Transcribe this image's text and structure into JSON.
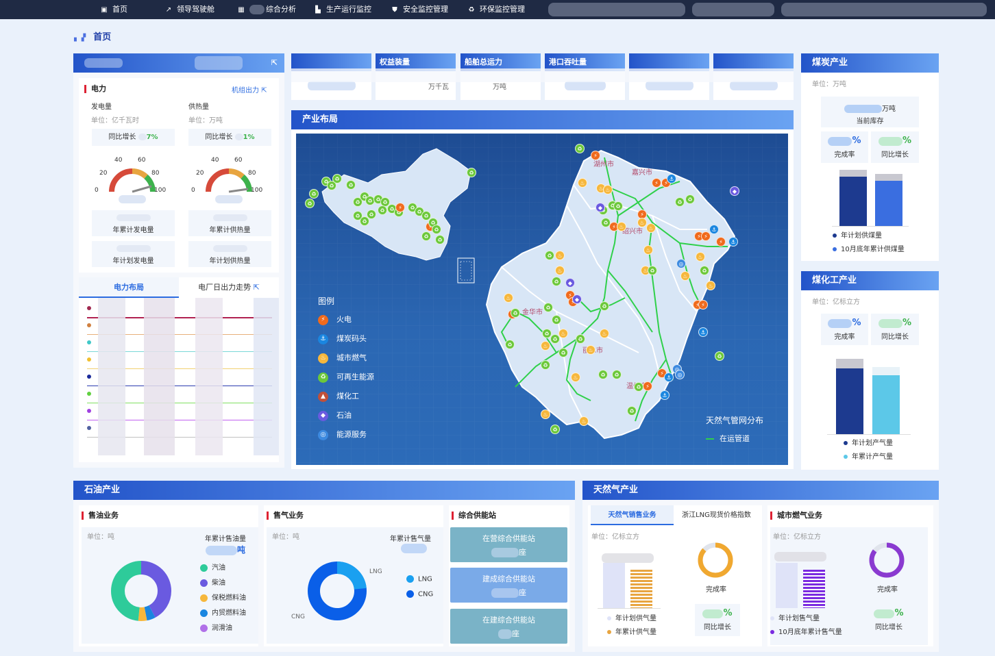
{
  "nav": {
    "items": [
      {
        "label": "首页",
        "icon": "home-icon"
      },
      {
        "label": "领导驾驶舱",
        "icon": "chart-line-icon"
      },
      {
        "label": "综合分析",
        "icon": "grid-icon"
      },
      {
        "label": "生产运行监控",
        "icon": "factory-icon"
      },
      {
        "label": "安全监控管理",
        "icon": "shield-icon"
      },
      {
        "label": "环保监控管理",
        "icon": "recycle-icon"
      }
    ]
  },
  "breadcrumb": {
    "label": "首页"
  },
  "top_metrics": {
    "labels": [
      "权益装量",
      "船舶总运力",
      "港口吞吐量"
    ],
    "values": [
      "万千瓦",
      "万吨"
    ]
  },
  "power": {
    "title": "电力",
    "link": "机组出力",
    "gen": {
      "title": "发电量",
      "unit": "单位：亿千瓦时",
      "growth_label": "同比增长",
      "growth_pct": "7%",
      "acc_label": "年累计发电量",
      "plan_label": "年计划发电量"
    },
    "heat": {
      "title": "供热量",
      "unit": "单位：万吨",
      "growth_label": "同比增长",
      "growth_pct": "1%",
      "acc_label": "年累计供热量",
      "plan_label": "年计划供热量"
    },
    "gauge_ticks": [
      "0",
      "20",
      "40",
      "60",
      "80",
      "100"
    ],
    "tabs": [
      "电力布局",
      "电厂日出力走势"
    ]
  },
  "coal": {
    "title": "煤炭产业",
    "unit": "单位：万吨",
    "stock_unit": "万吨",
    "stock_label": "当前库存",
    "pct_symbol": "%",
    "rate_label": "完成率",
    "growth_label": "同比增长",
    "legend": [
      "年计划供煤量",
      "10月底年累计供煤量"
    ]
  },
  "coalchem": {
    "title": "煤化工产业",
    "unit": "单位：亿标立方",
    "pct_symbol": "%",
    "rate_label": "完成率",
    "growth_label": "同比增长",
    "legend": [
      "年计划产气量",
      "年累计产气量"
    ]
  },
  "layout_panel": {
    "title": "产业布局",
    "legend_title": "图例",
    "legend": [
      "火电",
      "煤炭码头",
      "城市燃气",
      "可再生能源",
      "煤化工",
      "石油",
      "能源服务"
    ],
    "pipe_title": "天然气管网分布",
    "pipe_legend": "在运管道",
    "cities": [
      "湖州市",
      "嘉兴市",
      "绍兴市",
      "金华市",
      "丽水市",
      "温州市"
    ]
  },
  "oil": {
    "title": "石油产业",
    "sell": {
      "title": "售油业务",
      "unit": "单位：吨",
      "acc_label": "年累计售油量",
      "acc_unit": "吨",
      "legend": [
        "汽油",
        "柴油",
        "保税燃料油",
        "内贸燃料油",
        "润滑油"
      ]
    },
    "gas": {
      "title": "售气业务",
      "unit": "单位：吨",
      "acc_label": "年累计售气量",
      "legend": [
        "LNG",
        "CNG"
      ]
    },
    "station": {
      "title": "综合供能站",
      "buttons": [
        {
          "label": "在营综合供能站",
          "unit": "座"
        },
        {
          "label": "建成综合供能站",
          "unit": "座"
        },
        {
          "label": "在建综合供能站",
          "unit": "座"
        }
      ]
    }
  },
  "natgas": {
    "title": "天然气产业",
    "tabs": [
      "天然气销售业务",
      "浙江LNG现货价格指数"
    ],
    "sales": {
      "unit": "单位：亿标立方",
      "rate_label": "完成率",
      "growth_label": "同比增长",
      "pct_symbol": "%",
      "legend": [
        "年计划供气量",
        "年累计供气量"
      ]
    },
    "city": {
      "title": "城市燃气业务",
      "unit": "单位：亿标立方",
      "rate_label": "完成率",
      "growth_label": "同比增长",
      "pct_symbol": "%",
      "legend": [
        "年计划售气量",
        "10月底年累计售气量"
      ]
    }
  }
}
